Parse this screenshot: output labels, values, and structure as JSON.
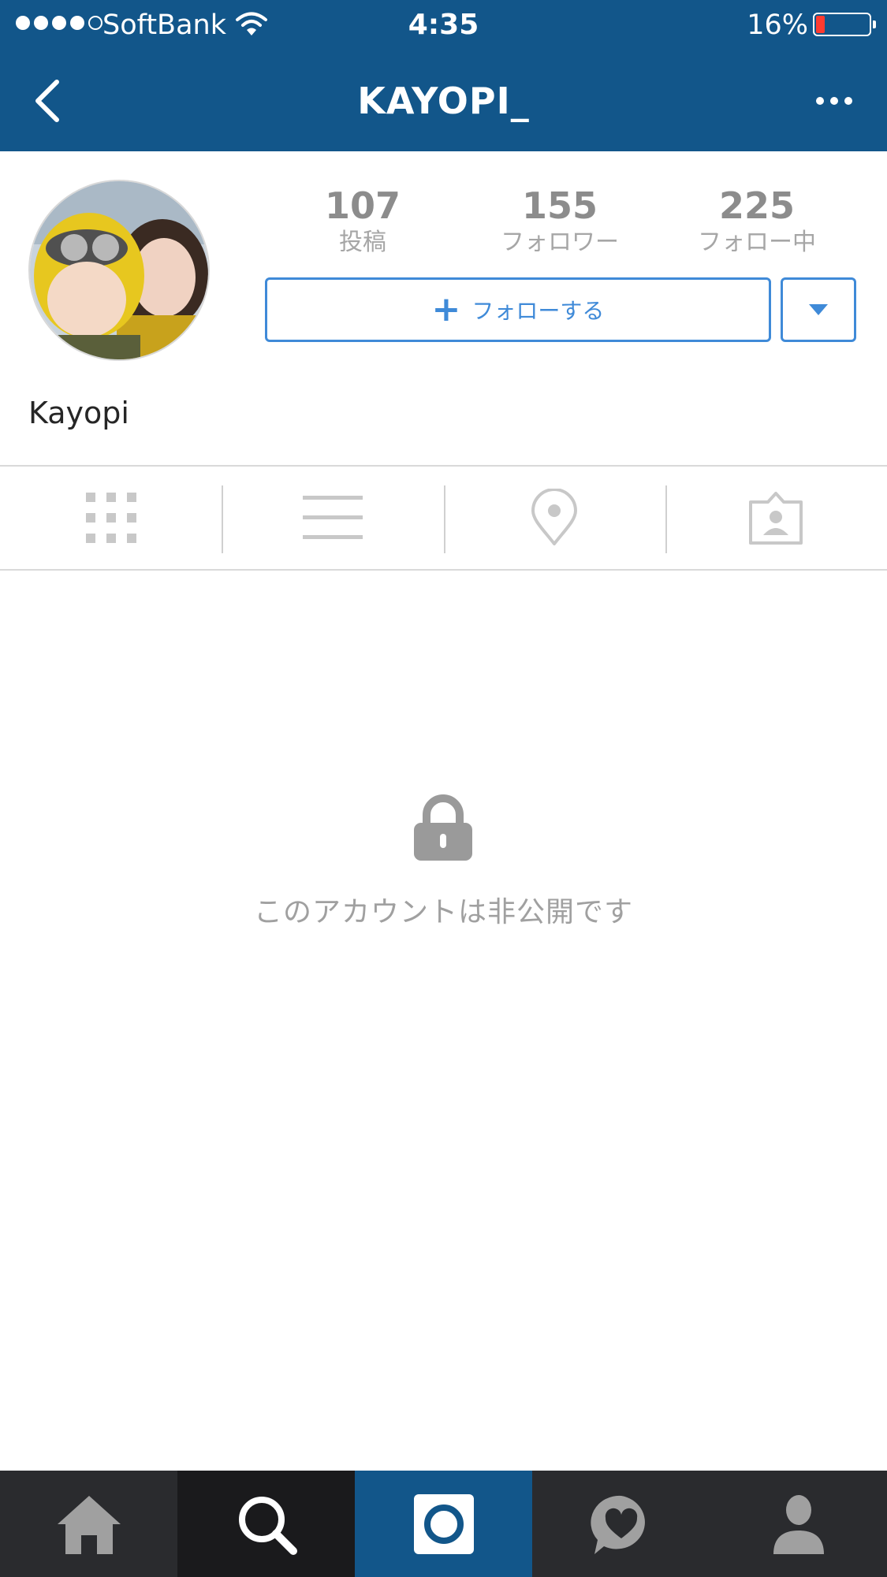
{
  "status_bar": {
    "carrier": "SoftBank",
    "time": "4:35",
    "battery_percent": "16%",
    "battery_level": 0.16,
    "signal_bars_filled": 4,
    "signal_bars_total": 5
  },
  "header": {
    "title": "KAYOPI_",
    "back_icon": "chevron-left-icon",
    "more_icon": "more-horizontal-icon"
  },
  "profile": {
    "stats": [
      {
        "value": "107",
        "label": "投稿"
      },
      {
        "value": "155",
        "label": "フォロワー"
      },
      {
        "value": "225",
        "label": "フォロー中"
      }
    ],
    "follow_button": {
      "plus": "+",
      "label": "フォローする"
    },
    "display_name": "Kayopi"
  },
  "tabs": [
    {
      "icon": "grid-icon"
    },
    {
      "icon": "list-icon"
    },
    {
      "icon": "map-pin-icon"
    },
    {
      "icon": "tagged-person-icon"
    }
  ],
  "private_notice": {
    "icon": "lock-icon",
    "text": "このアカウントは非公開です"
  },
  "bottom_nav": [
    {
      "icon": "home-icon"
    },
    {
      "icon": "search-icon"
    },
    {
      "icon": "camera-icon"
    },
    {
      "icon": "activity-heart-icon"
    },
    {
      "icon": "profile-icon"
    }
  ],
  "colors": {
    "header_bg": "#12568a",
    "accent": "#3f8ad8",
    "battery_low": "#ff3b30",
    "tab_bar_bg": "#2a2b2e"
  }
}
